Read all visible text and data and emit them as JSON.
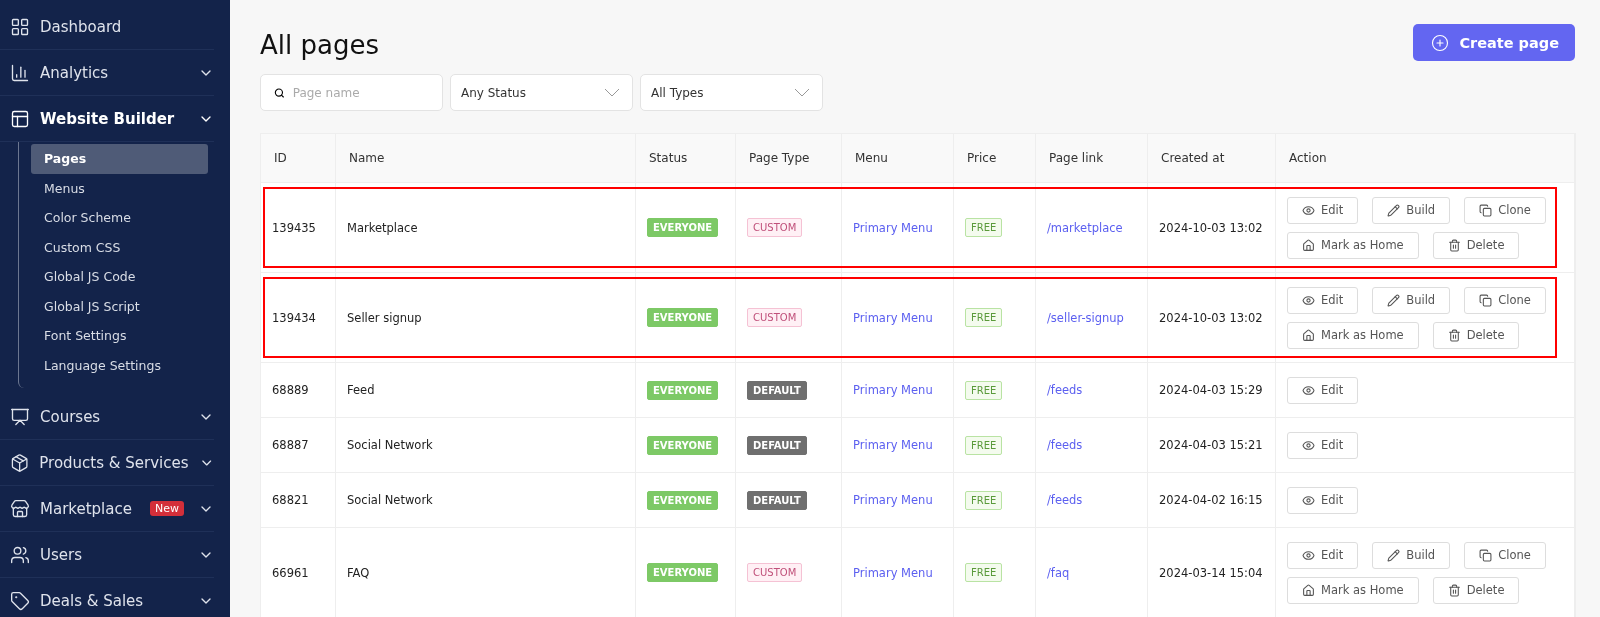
{
  "sidebar": {
    "items": [
      {
        "kind": "dashboard",
        "label": "Dashboard",
        "expandable": false,
        "expanded": false
      },
      {
        "kind": "analytics",
        "label": "Analytics",
        "expandable": true,
        "expanded": false
      },
      {
        "kind": "builder",
        "label": "Website Builder",
        "expandable": true,
        "expanded": true,
        "children": [
          {
            "label": "Pages",
            "selected": true
          },
          {
            "label": "Menus",
            "selected": false
          },
          {
            "label": "Color Scheme",
            "selected": false
          },
          {
            "label": "Custom CSS",
            "selected": false
          },
          {
            "label": "Global JS Code",
            "selected": false
          },
          {
            "label": "Global JS Script",
            "selected": false
          },
          {
            "label": "Font Settings",
            "selected": false
          },
          {
            "label": "Language Settings",
            "selected": false
          }
        ]
      },
      {
        "kind": "courses",
        "label": "Courses",
        "expandable": true,
        "expanded": false
      },
      {
        "kind": "products",
        "label": "Products & Services",
        "expandable": true,
        "expanded": false
      },
      {
        "kind": "marketplace",
        "label": "Marketplace",
        "badge": "New",
        "expandable": true,
        "expanded": false
      },
      {
        "kind": "users",
        "label": "Users",
        "expandable": true,
        "expanded": false
      },
      {
        "kind": "deals",
        "label": "Deals & Sales",
        "expandable": true,
        "expanded": false
      }
    ]
  },
  "page": {
    "title": "All pages",
    "create_button": "Create page"
  },
  "filters": {
    "search": {
      "placeholder": "Page name"
    },
    "status": "Any Status",
    "type": "All Types"
  },
  "table": {
    "columns": [
      "ID",
      "Name",
      "Status",
      "Page Type",
      "Menu",
      "Price",
      "Page link",
      "Created at",
      "Action"
    ],
    "rows": [
      {
        "id": "139435",
        "name": "Marketplace",
        "status": "EVERYONE",
        "page_type": {
          "kind": "custom",
          "label": "CUSTOM"
        },
        "menu": "Primary Menu",
        "price": "FREE",
        "link": "/marketplace",
        "created": "2024-10-03 13:02",
        "highlighted": true,
        "actions": [
          {
            "kind": "edit",
            "label": "Edit"
          },
          {
            "kind": "build",
            "label": "Build"
          },
          {
            "kind": "clone",
            "label": "Clone"
          },
          {
            "kind": "home",
            "label": "Mark as Home"
          },
          {
            "kind": "delete",
            "label": "Delete"
          }
        ]
      },
      {
        "id": "139434",
        "name": "Seller signup",
        "status": "EVERYONE",
        "page_type": {
          "kind": "custom",
          "label": "CUSTOM"
        },
        "menu": "Primary Menu",
        "price": "FREE",
        "link": "/seller-signup",
        "created": "2024-10-03 13:02",
        "highlighted": true,
        "actions": [
          {
            "kind": "edit",
            "label": "Edit"
          },
          {
            "kind": "build",
            "label": "Build"
          },
          {
            "kind": "clone",
            "label": "Clone"
          },
          {
            "kind": "home",
            "label": "Mark as Home"
          },
          {
            "kind": "delete",
            "label": "Delete"
          }
        ]
      },
      {
        "id": "68889",
        "name": "Feed",
        "status": "EVERYONE",
        "page_type": {
          "kind": "default",
          "label": "DEFAULT"
        },
        "menu": "Primary Menu",
        "price": "FREE",
        "link": "/feeds",
        "created": "2024-04-03 15:29",
        "highlighted": false,
        "actions": [
          {
            "kind": "edit",
            "label": "Edit"
          }
        ]
      },
      {
        "id": "68887",
        "name": "Social Network",
        "status": "EVERYONE",
        "page_type": {
          "kind": "default",
          "label": "DEFAULT"
        },
        "menu": "Primary Menu",
        "price": "FREE",
        "link": "/feeds",
        "created": "2024-04-03 15:21",
        "highlighted": false,
        "actions": [
          {
            "kind": "edit",
            "label": "Edit"
          }
        ]
      },
      {
        "id": "68821",
        "name": "Social Network",
        "status": "EVERYONE",
        "page_type": {
          "kind": "default",
          "label": "DEFAULT"
        },
        "menu": "Primary Menu",
        "price": "FREE",
        "link": "/feeds",
        "created": "2024-04-02 16:15",
        "highlighted": false,
        "actions": [
          {
            "kind": "edit",
            "label": "Edit"
          }
        ]
      },
      {
        "id": "66961",
        "name": "FAQ",
        "status": "EVERYONE",
        "page_type": {
          "kind": "custom",
          "label": "CUSTOM"
        },
        "menu": "Primary Menu",
        "price": "FREE",
        "link": "/faq",
        "created": "2024-03-14 15:04",
        "highlighted": false,
        "actions": [
          {
            "kind": "edit",
            "label": "Edit"
          },
          {
            "kind": "build",
            "label": "Build"
          },
          {
            "kind": "clone",
            "label": "Clone"
          },
          {
            "kind": "home",
            "label": "Mark as Home"
          },
          {
            "kind": "delete",
            "label": "Delete"
          }
        ]
      }
    ]
  }
}
